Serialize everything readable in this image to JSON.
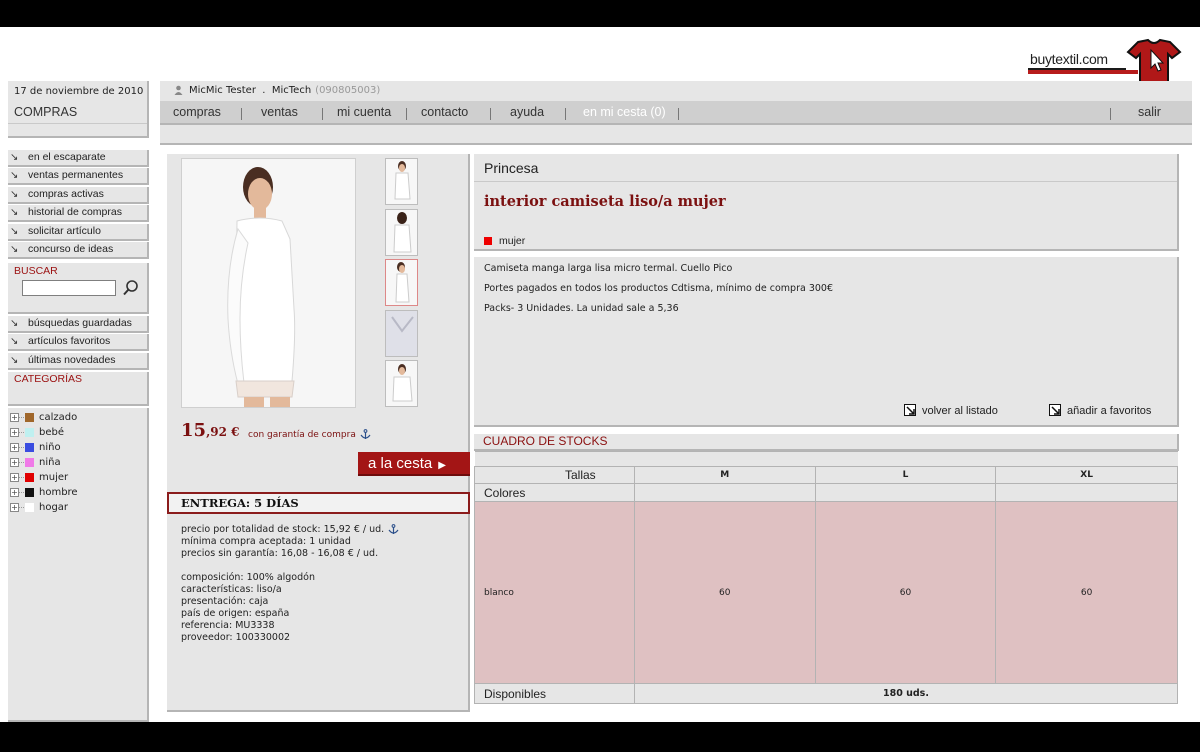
{
  "header": {
    "logo_text": "buytextil.com",
    "date": "17 de noviembre de 2010",
    "section": "COMPRAS",
    "user": "MicMic Tester",
    "company": "MicTech",
    "user_code": "(090805003)"
  },
  "nav": {
    "items": [
      "compras",
      "ventas",
      "mi cuenta",
      "contacto",
      "ayuda",
      "en mi cesta (0)"
    ],
    "logout": "salir"
  },
  "sidebar": {
    "menu": [
      "en el escaparate",
      "ventas permanentes",
      "compras activas",
      "historial de compras",
      "solicitar artículo",
      "concurso de ideas"
    ],
    "search_label": "BUSCAR",
    "search_value": "",
    "menu2": [
      "búsquedas guardadas",
      "artículos favoritos",
      "últimas novedades"
    ],
    "categories_label": "CATEGORÍAS",
    "categories": [
      {
        "label": "calzado",
        "color": "#a0672b"
      },
      {
        "label": "bebé",
        "color": "#bff0f0"
      },
      {
        "label": "niño",
        "color": "#3a4de0"
      },
      {
        "label": "niña",
        "color": "#f07ae8"
      },
      {
        "label": "mujer",
        "color": "#e00000"
      },
      {
        "label": "hombre",
        "color": "#111111"
      },
      {
        "label": "hogar",
        "color": "#ffffff"
      }
    ]
  },
  "product": {
    "brand": "Princesa",
    "title": "interior camiseta liso/a mujer",
    "tag": "mujer",
    "price_int": "15",
    "price_dec": ",92 €",
    "guarantee": "con garantía de compra",
    "cart_button": "a la cesta",
    "delivery": "ENTREGA: 5 DÍAS",
    "details": {
      "stock_price": "precio por totalidad de stock:  15,92 € / ud.",
      "min_purchase": "mínima compra aceptada:  1 unidad",
      "no_guarantee": "precios sin garantía:  16,08 - 16,08 € / ud.",
      "composition": "composición:  100% algodón",
      "features": "características:  liso/a",
      "presentation": "presentación:  caja",
      "origin": "país de origen:  españa",
      "reference": "referencia:  MU3338",
      "supplier": "proveedor:  100330002"
    },
    "description": [
      "Camiseta manga larga lisa micro termal. Cuello Pico",
      "Portes pagados en todos los productos Cdtisma, mínimo de compra 300€",
      "Packs- 3 Unidades. La unidad sale a 5,36"
    ],
    "back_link": "volver al listado",
    "fav_link": "añadir a favoritos"
  },
  "stocks": {
    "title": "CUADRO DE STOCKS",
    "sizes_label": "Tallas",
    "colors_label": "Colores",
    "sizes": [
      "M",
      "L",
      "XL"
    ],
    "rows": [
      {
        "color": "blanco",
        "values": [
          "60",
          "60",
          "60"
        ]
      }
    ],
    "available_label": "Disponibles",
    "available_total": "180 uds."
  }
}
